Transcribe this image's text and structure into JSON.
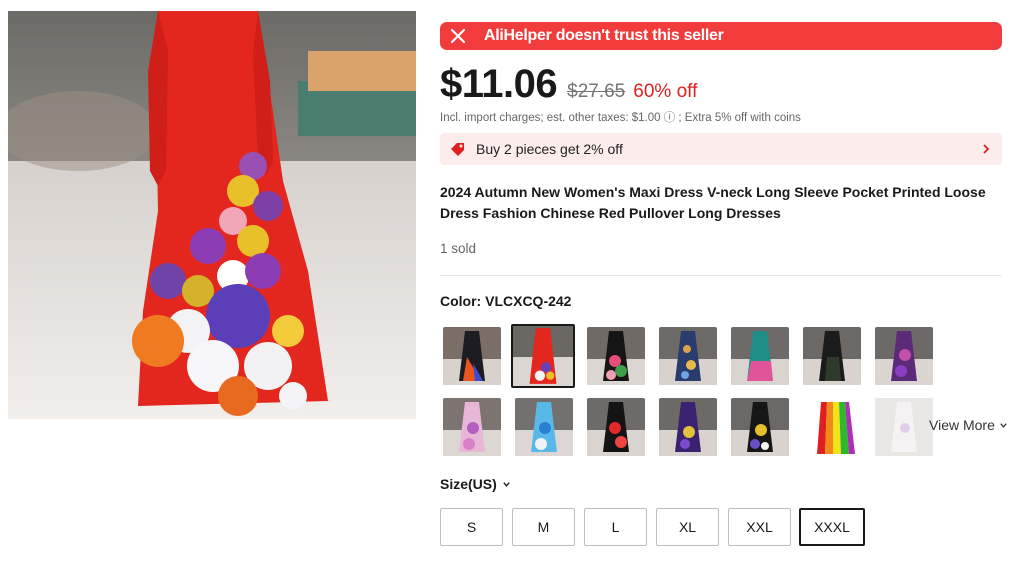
{
  "alert": {
    "text": "AliHelper doesn't trust this seller",
    "icon": "close-icon",
    "color": "#f23c3c"
  },
  "price": {
    "current": "$11.06",
    "original": "$27.65",
    "discount": "60% off",
    "tax_note": "Incl. import charges; est. other taxes: $1.00 ⓘ ; Extra 5% off with coins"
  },
  "promo": {
    "text": "Buy 2 pieces get 2% off",
    "icon": "tag-icon",
    "arrow": "chevron-right-icon"
  },
  "product": {
    "title": "2024 Autumn New Women's Maxi Dress V-neck Long Sleeve Pocket Printed Loose Dress Fashion Chinese Red Pullover Long Dresses",
    "sold": "1 sold"
  },
  "color": {
    "label": "Color: VLCXCQ-242",
    "view_more": "View More"
  },
  "size": {
    "label": "Size(US)",
    "options": [
      "S",
      "M",
      "L",
      "XL",
      "XXL",
      "XXXL"
    ],
    "selected": "XXXL"
  }
}
